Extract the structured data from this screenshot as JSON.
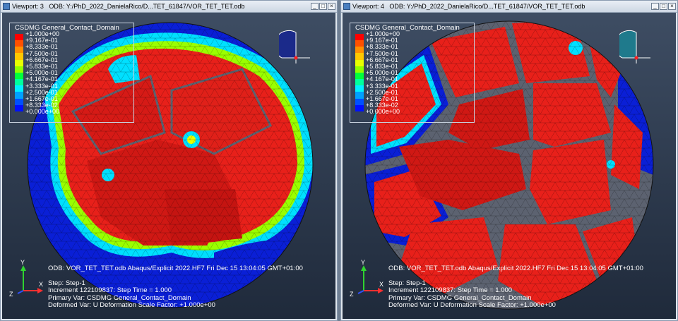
{
  "viewports": [
    {
      "title": "Viewport: 3",
      "odb_path": "ODB: Y:/PhD_2022_DanielaRico/D...TET_61847/VOR_TET_TET.odb",
      "legend": {
        "title": "CSDMG General_Contact_Domain",
        "values": [
          "+1.000e+00",
          "+9.167e-01",
          "+8.333e-01",
          "+7.500e-01",
          "+6.667e-01",
          "+5.833e-01",
          "+5.000e-01",
          "+4.167e-01",
          "+3.333e-01",
          "+2.500e-01",
          "+1.667e-01",
          "+8.333e-02",
          "+0.000e+00"
        ]
      },
      "info": {
        "odb_line": "ODB: VOR_TET_TET.odb    Abaqus/Explicit 2022.HF7    Fri Dec 15 13:04:05 GMT+01:00",
        "step": "Step: Step-1",
        "increment": "Increment 122109837: Step Time =    1.000",
        "primary": "Primary Var: CSDMG General_Contact_Domain",
        "deformed": "Deformed Var: U   Deformation Scale Factor: +1.000e+00"
      },
      "axes": {
        "x": "X",
        "y": "Y",
        "z": "Z"
      }
    },
    {
      "title": "Viewport: 4",
      "odb_path": "ODB: Y:/PhD_2022_DanielaRico/D...TET_61847/VOR_TET_TET.odb",
      "legend": {
        "title": "CSDMG General_Contact_Domain",
        "values": [
          "+1.000e+00",
          "+9.167e-01",
          "+8.333e-01",
          "+7.500e-01",
          "+6.667e-01",
          "+5.833e-01",
          "+5.000e-01",
          "+4.167e-01",
          "+3.333e-01",
          "+2.500e-01",
          "+1.667e-01",
          "+8.333e-02",
          "+0.000e+00"
        ]
      },
      "info": {
        "odb_line": "ODB: VOR_TET_TET.odb    Abaqus/Explicit 2022.HF7    Fri Dec 15 13:04:05 GMT+01:00",
        "step": "Step: Step-1",
        "increment": "Increment 122109837: Step Time =    1.000",
        "primary": "Primary Var: CSDMG General_Contact_Domain",
        "deformed": "Deformed Var: U   Deformation Scale Factor: +1.000e+00"
      },
      "axes": {
        "x": "X",
        "y": "Y",
        "z": "Z"
      }
    }
  ],
  "window_buttons": {
    "minimize": "_",
    "maximize": "□",
    "close": "×"
  },
  "colors": {
    "legend_scale": [
      "#ff0000",
      "#ff5000",
      "#ff9000",
      "#ffc800",
      "#e8ff00",
      "#90ff00",
      "#00ff3c",
      "#00ff9c",
      "#00f0ff",
      "#00a0ff",
      "#0050ff",
      "#0010ff",
      "#0000d0"
    ],
    "viewport_bg_top": "#3e4d63",
    "viewport_bg_bottom": "#1f2a3b",
    "contact_red": "#e8201a",
    "no_contact_blue": "#0a1fd6",
    "gap_gray": "#5c6270"
  }
}
